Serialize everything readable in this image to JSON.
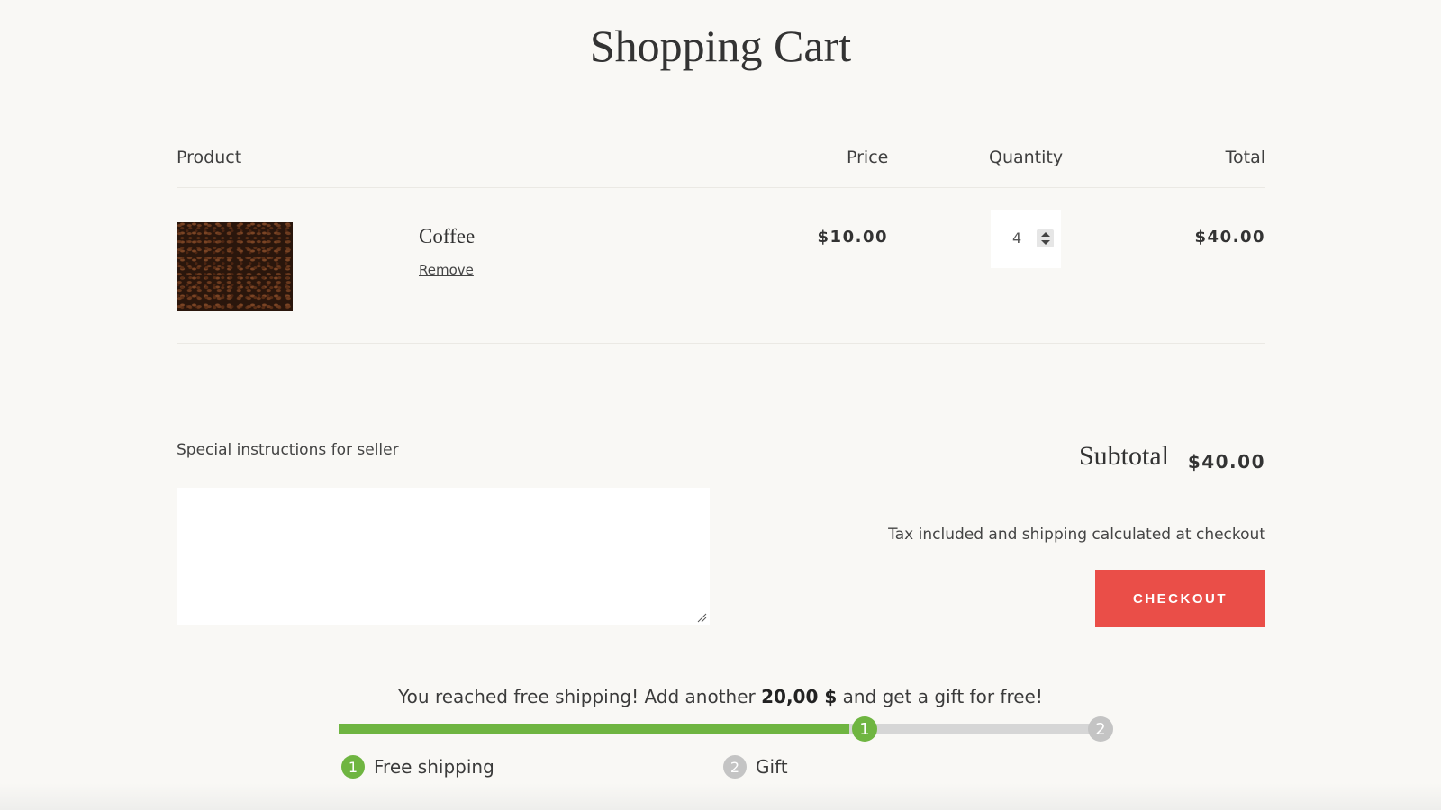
{
  "page": {
    "title": "Shopping Cart"
  },
  "table": {
    "headers": {
      "product": "Product",
      "price": "Price",
      "quantity": "Quantity",
      "total": "Total"
    }
  },
  "cart_items": [
    {
      "name": "Coffee",
      "remove_label": "Remove",
      "price": "$10.00",
      "quantity": "4",
      "total": "$40.00"
    }
  ],
  "instructions": {
    "label": "Special instructions for seller",
    "value": ""
  },
  "summary": {
    "subtotal_label": "Subtotal",
    "subtotal_value": "$40.00",
    "tax_note": "Tax included and shipping calculated at checkout",
    "checkout_label": "CHECKOUT"
  },
  "promo": {
    "message_before": "You reached free shipping! Add another ",
    "amount": "20,00 $",
    "message_after": " and get a gift for free!",
    "progress_percent": 67,
    "steps": [
      {
        "number": "1",
        "label": "Free shipping",
        "reached": true
      },
      {
        "number": "2",
        "label": "Gift",
        "reached": false
      }
    ]
  },
  "colors": {
    "accent_red": "#ea4e48",
    "progress_green": "#6fb541",
    "progress_gray": "#d6d6d6",
    "step_inactive": "#c4c4c4"
  },
  "icons": {
    "quantity_stepper": "up-down-arrows-icon",
    "textarea_resize": "resize-grip-icon"
  }
}
